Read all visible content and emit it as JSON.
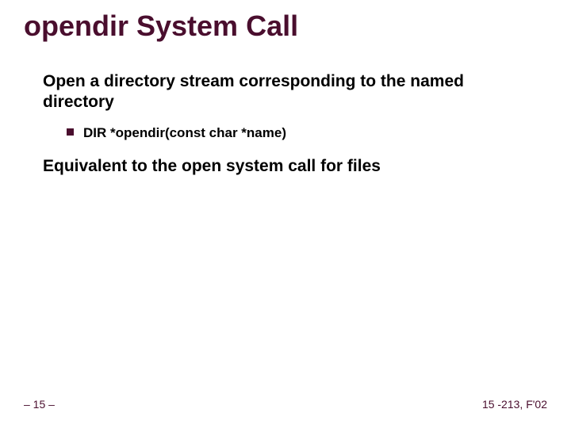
{
  "title": "opendir System Call",
  "body": {
    "p1": "Open a directory stream corresponding to the named directory",
    "p1_sub1": "DIR *opendir(const char *name)",
    "p2": "Equivalent to the open system call for files"
  },
  "footer": {
    "left": "– 15 –",
    "right": "15 -213, F'02"
  }
}
